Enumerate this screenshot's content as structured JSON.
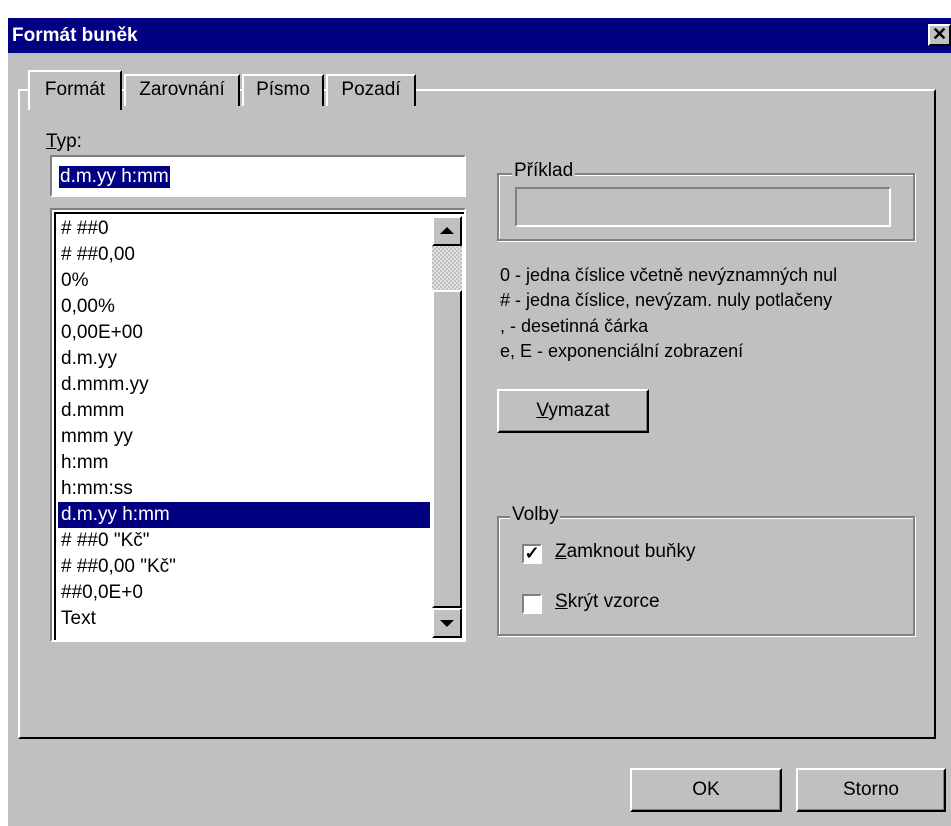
{
  "window": {
    "title": "Formát buněk",
    "close_glyph": "✕"
  },
  "tabs": [
    {
      "label": "Formát",
      "active": true
    },
    {
      "label": "Zarovnání",
      "active": false
    },
    {
      "label": "Písmo",
      "active": false
    },
    {
      "label": "Pozadí",
      "active": false
    }
  ],
  "type_section": {
    "label_accel": "T",
    "label_rest": "yp:",
    "value": "d.m.yy h:mm"
  },
  "format_list": {
    "items": [
      "# ##0",
      "# ##0,00",
      "0%",
      "0,00%",
      "0,00E+00",
      "d.m.yy",
      "d.mmm.yy",
      "d.mmm",
      "mmm yy",
      "h:mm",
      "h:mm:ss",
      "d.m.yy h:mm",
      "# ##0 \"Kč\"",
      "# ##0,00 \"Kč\"",
      "##0,0E+0",
      "Text"
    ],
    "selected_index": 11,
    "scroll_up_icon": "▲",
    "scroll_down_icon": "▼"
  },
  "example": {
    "label": "Příklad",
    "value": ""
  },
  "legend": [
    "0 - jedna číslice včetně nevýznamných nul",
    "# - jedna číslice, nevýzam. nuly potlačeny",
    ",  - desetinná čárka",
    "e, E - exponenciální zobrazení"
  ],
  "clear_button": {
    "accel": "V",
    "rest": "ymazat"
  },
  "options": {
    "label": "Volby",
    "lock_cells": {
      "accel": "Z",
      "rest": "amknout buňky",
      "checked": true,
      "check_glyph": "✓"
    },
    "hide_formulas": {
      "accel": "S",
      "rest": "krýt vzorce",
      "checked": false
    }
  },
  "buttons": {
    "ok": "OK",
    "cancel": "Storno"
  },
  "colors": {
    "face": "#c0c0c0",
    "title_bar": "#000080",
    "selection": "#000080"
  }
}
